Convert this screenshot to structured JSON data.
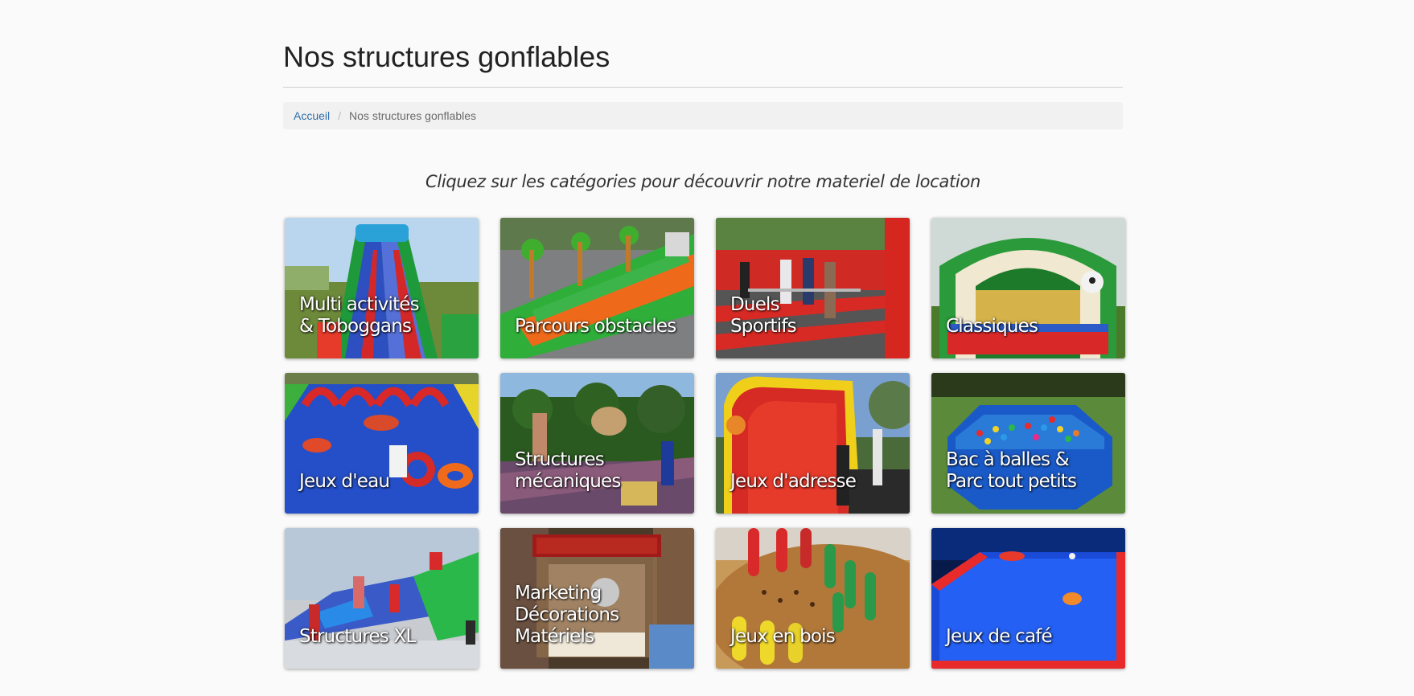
{
  "page": {
    "title": "Nos structures gonflables",
    "intro": "Cliquez sur les catégories pour découvrir notre materiel de location"
  },
  "breadcrumb": {
    "home": "Accueil",
    "current": "Nos structures gonflables"
  },
  "categories": [
    {
      "label": "Multi activités\n& Toboggans",
      "icon": "slide-image"
    },
    {
      "label": "Parcours obstacles",
      "icon": "obstacle-course-image"
    },
    {
      "label": "Duels\nSportifs",
      "icon": "sport-duel-image"
    },
    {
      "label": "Classiques",
      "icon": "bounce-house-image"
    },
    {
      "label": "Jeux d'eau",
      "icon": "water-slide-image"
    },
    {
      "label": "Structures\nmécaniques",
      "icon": "mechanical-ride-image"
    },
    {
      "label": "Jeux d'adresse",
      "icon": "skill-game-image"
    },
    {
      "label": "Bac à balles &\nParc tout petits",
      "icon": "ball-pit-image"
    },
    {
      "label": "Structures XL",
      "icon": "xl-structure-image"
    },
    {
      "label": "Marketing\nDécorations\nMatériels",
      "icon": "popcorn-machine-image"
    },
    {
      "label": "Jeux en bois",
      "icon": "wooden-game-image"
    },
    {
      "label": "Jeux de café",
      "icon": "air-hockey-image"
    }
  ]
}
